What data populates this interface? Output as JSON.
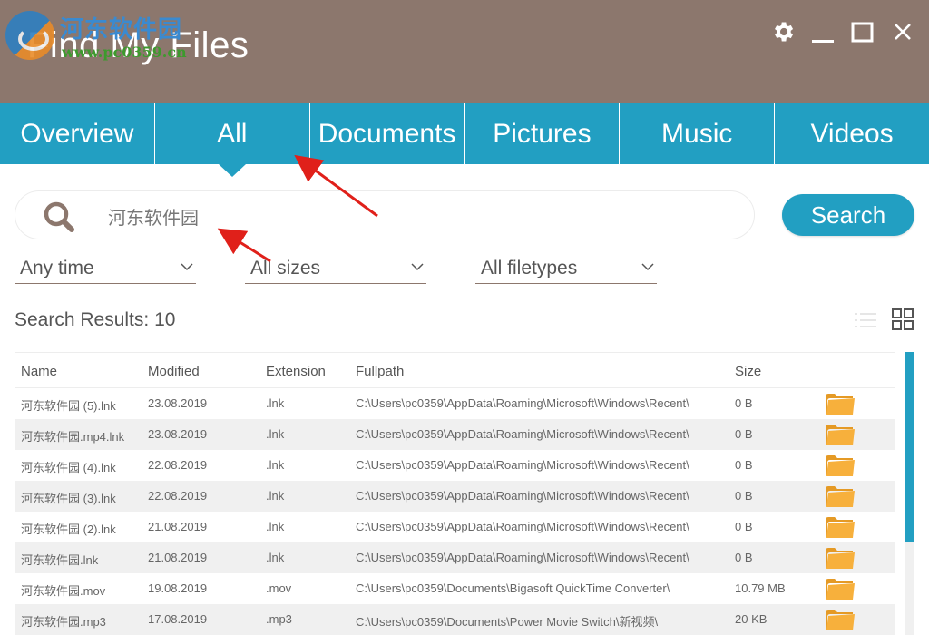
{
  "app": {
    "title": "Find My Files",
    "watermark_cn": "河东软件园",
    "watermark_url": "www.pc0359.cn"
  },
  "window_controls": {
    "settings": "gear-icon",
    "minimize": "minimize-icon",
    "maximize": "maximize-icon",
    "close": "close-icon"
  },
  "tabs": [
    {
      "label": "Overview",
      "active": false
    },
    {
      "label": "All",
      "active": true
    },
    {
      "label": "Documents",
      "active": false
    },
    {
      "label": "Pictures",
      "active": false
    },
    {
      "label": "Music",
      "active": false
    },
    {
      "label": "Videos",
      "active": false
    }
  ],
  "search": {
    "value": "河东软件园",
    "placeholder": "",
    "button_label": "Search"
  },
  "filters": {
    "time": "Any time",
    "size": "All sizes",
    "filetype": "All filetypes"
  },
  "results": {
    "label": "Search Results:",
    "count": "10"
  },
  "table": {
    "columns": [
      "Name",
      "Modified",
      "Extension",
      "Fullpath",
      "Size"
    ],
    "rows": [
      {
        "name": "河东软件园 (5).lnk",
        "modified": "23.08.2019",
        "extension": ".lnk",
        "fullpath": "C:\\Users\\pc0359\\AppData\\Roaming\\Microsoft\\Windows\\Recent\\",
        "size": "0 B"
      },
      {
        "name": "河东软件园.mp4.lnk",
        "modified": "23.08.2019",
        "extension": ".lnk",
        "fullpath": "C:\\Users\\pc0359\\AppData\\Roaming\\Microsoft\\Windows\\Recent\\",
        "size": "0 B"
      },
      {
        "name": "河东软件园 (4).lnk",
        "modified": "22.08.2019",
        "extension": ".lnk",
        "fullpath": "C:\\Users\\pc0359\\AppData\\Roaming\\Microsoft\\Windows\\Recent\\",
        "size": "0 B"
      },
      {
        "name": "河东软件园 (3).lnk",
        "modified": "22.08.2019",
        "extension": ".lnk",
        "fullpath": "C:\\Users\\pc0359\\AppData\\Roaming\\Microsoft\\Windows\\Recent\\",
        "size": "0 B"
      },
      {
        "name": "河东软件园 (2).lnk",
        "modified": "21.08.2019",
        "extension": ".lnk",
        "fullpath": "C:\\Users\\pc0359\\AppData\\Roaming\\Microsoft\\Windows\\Recent\\",
        "size": "0 B"
      },
      {
        "name": "河东软件园.lnk",
        "modified": "21.08.2019",
        "extension": ".lnk",
        "fullpath": "C:\\Users\\pc0359\\AppData\\Roaming\\Microsoft\\Windows\\Recent\\",
        "size": "0 B"
      },
      {
        "name": "河东软件园.mov",
        "modified": "19.08.2019",
        "extension": ".mov",
        "fullpath": "C:\\Users\\pc0359\\Documents\\Bigasoft QuickTime Converter\\",
        "size": "10.79 MB"
      },
      {
        "name": "河东软件园.mp3",
        "modified": "17.08.2019",
        "extension": ".mp3",
        "fullpath": "C:\\Users\\pc0359\\Documents\\Power Movie Switch\\新视频\\",
        "size": "20 KB"
      }
    ]
  },
  "colors": {
    "titlebar": "#8c776d",
    "accent": "#229fc2",
    "folder": "#f7b03c",
    "annotation": "#e0201a"
  }
}
